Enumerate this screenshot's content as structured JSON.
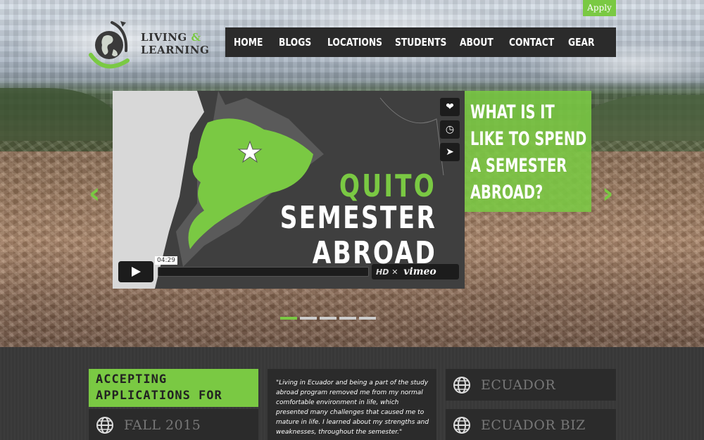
{
  "header": {
    "apply_label": "Apply",
    "logo_line1": "LIVING",
    "logo_amp": "&",
    "logo_line2": "LEARNING"
  },
  "nav": {
    "items": [
      {
        "label": "HOME"
      },
      {
        "label": "BLOGS"
      },
      {
        "label": "LOCATIONS"
      },
      {
        "label": "STUDENTS"
      },
      {
        "label": "ABOUT"
      },
      {
        "label": "CONTACT"
      },
      {
        "label": "GEAR"
      }
    ]
  },
  "video": {
    "headline_green": "QUITO",
    "headline_white_1": "SEMESTER",
    "headline_white_2": "ABROAD",
    "timecode": "04:29",
    "hd_label": "HD",
    "vimeo_label": "vimeo"
  },
  "slide": {
    "question_lines": [
      "WHAT IS IT",
      "LIKE TO SPEND",
      "A SEMESTER",
      "ABROAD?"
    ]
  },
  "lower": {
    "accept_line1": "ACCEPTING",
    "accept_line2": "APPLICATIONS FOR",
    "term": "FALL 2015",
    "quote": "\"Living in Ecuador and being a part of the study abroad program removed me from my normal comfortable environment in life, which presented many challenges that caused me to mature in life. I learned about my strengths and weaknesses, throughout the semester.\"",
    "programs": [
      {
        "label": "ECUADOR"
      },
      {
        "label": "ECUADOR BIZ"
      }
    ]
  },
  "colors": {
    "accent": "#7ac943",
    "dark": "#2b2b2b"
  }
}
